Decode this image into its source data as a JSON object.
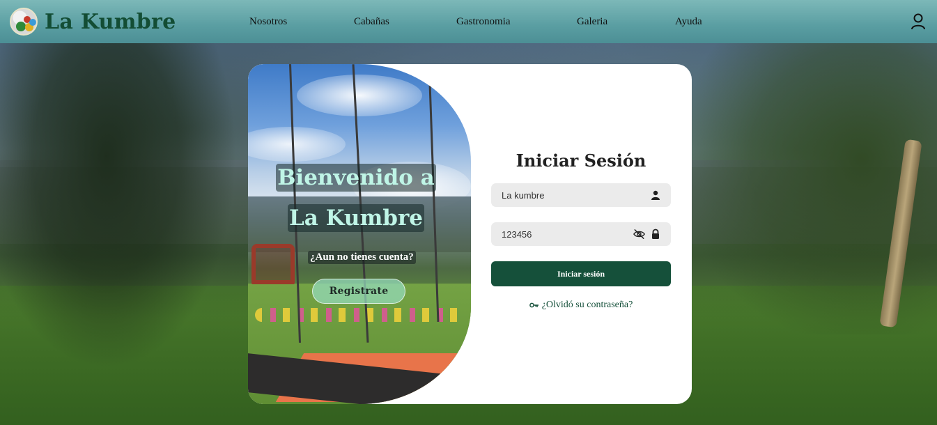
{
  "brand": {
    "name": "La Kumbre",
    "logo_icon": "la-kumbre-logo"
  },
  "nav": {
    "items": [
      {
        "label": "Nosotros"
      },
      {
        "label": "Cabañas"
      },
      {
        "label": "Gastronomia"
      },
      {
        "label": "Galeria"
      },
      {
        "label": "Ayuda"
      }
    ],
    "user_icon": "user-icon"
  },
  "welcome": {
    "line1": "Bienvenido a",
    "line2": "La Kumbre",
    "no_account": "¿Aun no tienes cuenta?",
    "register_label": "Registrate"
  },
  "login": {
    "title": "Iniciar Sesión",
    "username_value": "La kumbre",
    "password_value": "123456",
    "submit_label": "Iniciar sesión",
    "forgot_label": "¿Olvidó su contraseña?"
  },
  "colors": {
    "primary": "#15503a",
    "navbar": "#5a9ea2",
    "accent_text": "#bff5e6"
  }
}
